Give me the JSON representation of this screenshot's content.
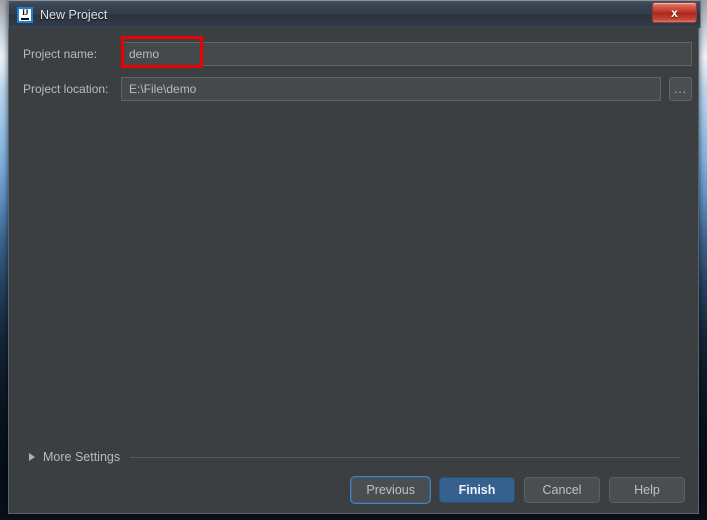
{
  "window": {
    "title": "New Project",
    "icon": "intellij-idea-icon",
    "close_label": "x"
  },
  "form": {
    "name_label": "Project name:",
    "name_value": "demo",
    "name_placeholder": "",
    "location_label": "Project location:",
    "location_value": "E:\\File\\demo",
    "location_placeholder": "",
    "browse_label": "..."
  },
  "more_settings": {
    "label": "More Settings",
    "expanded": false
  },
  "footer": {
    "previous_label": "Previous",
    "finish_label": "Finish",
    "cancel_label": "Cancel",
    "help_label": "Help"
  },
  "colors": {
    "panel_bg": "#3c3f41",
    "field_bg": "#45494a",
    "accent_primary": "#36618f",
    "annotation": "#ee0000",
    "titlebar": "#2b343e",
    "close_button": "#b93226"
  }
}
